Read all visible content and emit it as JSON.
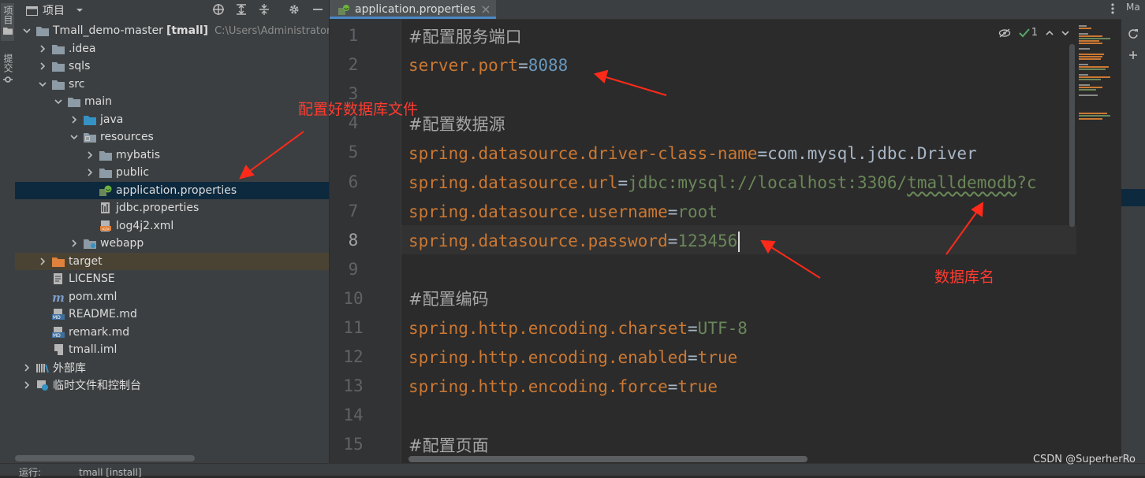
{
  "left_strip": {
    "project_tab": "项目",
    "commit_tab": "提交"
  },
  "project_panel": {
    "title": "项目",
    "tree": [
      {
        "label": "Tmall_demo-master",
        "suffix": "[tmall]",
        "path": "C:\\Users\\Administrator\\De",
        "icon": "folder-icon",
        "expanded": true
      },
      {
        "label": ".idea",
        "icon": "folder-icon",
        "expanded": false
      },
      {
        "label": "sqls",
        "icon": "folder-icon",
        "expanded": false
      },
      {
        "label": "src",
        "icon": "folder-icon",
        "expanded": true
      },
      {
        "label": "main",
        "icon": "folder-icon",
        "expanded": true
      },
      {
        "label": "java",
        "icon": "source-folder-icon",
        "expanded": false
      },
      {
        "label": "resources",
        "icon": "resources-folder-icon",
        "expanded": true
      },
      {
        "label": "mybatis",
        "icon": "folder-icon",
        "expanded": false
      },
      {
        "label": "public",
        "icon": "folder-icon",
        "expanded": false
      },
      {
        "label": "application.properties",
        "icon": "spring-properties-icon",
        "selected": true
      },
      {
        "label": "jdbc.properties",
        "icon": "properties-file-icon"
      },
      {
        "label": "log4j2.xml",
        "icon": "xml-file-icon"
      },
      {
        "label": "webapp",
        "icon": "web-folder-icon",
        "expanded": false
      },
      {
        "label": "target",
        "icon": "excluded-folder-icon",
        "expanded": false,
        "highlighted": true
      },
      {
        "label": "LICENSE",
        "icon": "text-file-icon"
      },
      {
        "label": "pom.xml",
        "icon": "maven-icon"
      },
      {
        "label": "README.md",
        "icon": "markdown-icon"
      },
      {
        "label": "remark.md",
        "icon": "markdown-icon"
      },
      {
        "label": "tmall.iml",
        "icon": "iml-file-icon"
      },
      {
        "label": "外部库",
        "icon": "library-icon",
        "expanded": false
      },
      {
        "label": "临时文件和控制台",
        "icon": "scratches-icon",
        "expanded": false
      }
    ]
  },
  "editor": {
    "tab_label": "application.properties",
    "inspection_count": "1",
    "line_numbers": [
      "1",
      "2",
      "3",
      "4",
      "5",
      "6",
      "7",
      "8",
      "9",
      "10",
      "11",
      "12",
      "13",
      "14",
      "15"
    ],
    "current_line": "8",
    "lines": {
      "l1": {
        "comment": "#配置服务端口"
      },
      "l2": {
        "key": "server.port",
        "eq": "=",
        "value": "8088"
      },
      "l4": {
        "comment": "#配置数据源"
      },
      "l5": {
        "key": "spring.datasource.driver-class-name",
        "eq": "=",
        "value": "com.mysql.jdbc.Driver"
      },
      "l6": {
        "key": "spring.datasource.url",
        "eq": "=",
        "value_a": "jdbc:mysql://localhost:3306/",
        "value_b": "tmalldemodb",
        "value_c": "?c"
      },
      "l7": {
        "key": "spring.datasource.username",
        "eq": "=",
        "value": "root"
      },
      "l8": {
        "key": "spring.datasource.password",
        "eq": "=",
        "value": "123456"
      },
      "l10": {
        "comment": "#配置编码"
      },
      "l11": {
        "key": "spring.http.encoding.charset",
        "eq": "=",
        "value": "UTF-8"
      },
      "l12": {
        "key": "spring.http.encoding.enabled",
        "eq": "=",
        "value": "true"
      },
      "l13": {
        "key": "spring.http.encoding.force",
        "eq": "=",
        "value": "true"
      },
      "l15": {
        "comment": "#配置页面"
      }
    }
  },
  "right_strip": {
    "label": "Ma"
  },
  "bottom_bar": {
    "run_label": "运行:",
    "run_config": "tmall [install]"
  },
  "annotations": {
    "config_db_file": "配置好数据库文件",
    "db_name": "数据库名"
  },
  "watermark": "CSDN @SuperherRo",
  "colors": {
    "accent": "#4a88c7",
    "selection": "#0d293e",
    "annotation": "#ff3b30",
    "keyword": "#cc7832",
    "number": "#6897bb",
    "string": "#6a8759"
  }
}
